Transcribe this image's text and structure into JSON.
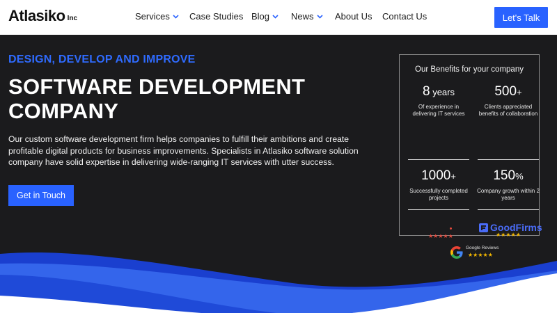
{
  "header": {
    "logo": "Atlasiko",
    "logo_suffix": "Inc",
    "nav": [
      {
        "label": "Services",
        "dropdown": true
      },
      {
        "label": "Case Studies",
        "dropdown": false
      },
      {
        "label": "Blog",
        "dropdown": true
      },
      {
        "label": "News",
        "dropdown": true
      },
      {
        "label": "About Us",
        "dropdown": false
      },
      {
        "label": "Contact Us",
        "dropdown": false
      }
    ],
    "cta_label": "Let's Talk"
  },
  "hero": {
    "eyebrow": "DESIGN, DEVELOP AND IMPROVE",
    "title": "SOFTWARE DEVELOPMENT COMPANY",
    "description": "Our custom software development firm helps companies to fulfill their ambitions and create profitable digital products for business improvements. Specialists in Atlasiko software solution company have solid expertise in delivering wide-ranging IT services with utter success.",
    "button_label": "Get in Touch"
  },
  "benefits": {
    "title": "Our Benefits for your company",
    "stats": [
      {
        "value": "8",
        "suffix": " years",
        "label": "Of experience in delivering IT services"
      },
      {
        "value": "500",
        "suffix": "+",
        "label": "Clients appreciated benefits of collaboration"
      },
      {
        "value": "1000",
        "suffix": "+",
        "label": "Successfully completed projects"
      },
      {
        "value": "150",
        "suffix": "%",
        "label": "Company growth within 2 years"
      }
    ],
    "goodfirms_label": "GoodFirms",
    "google_label": "Google Reviews",
    "star_rating": "★★★★★"
  },
  "colors": {
    "accent": "#2962ff",
    "hero_bg": "#1b1b1d",
    "wave_dark": "#1a3fcf",
    "wave_light": "#3a6cf0"
  }
}
